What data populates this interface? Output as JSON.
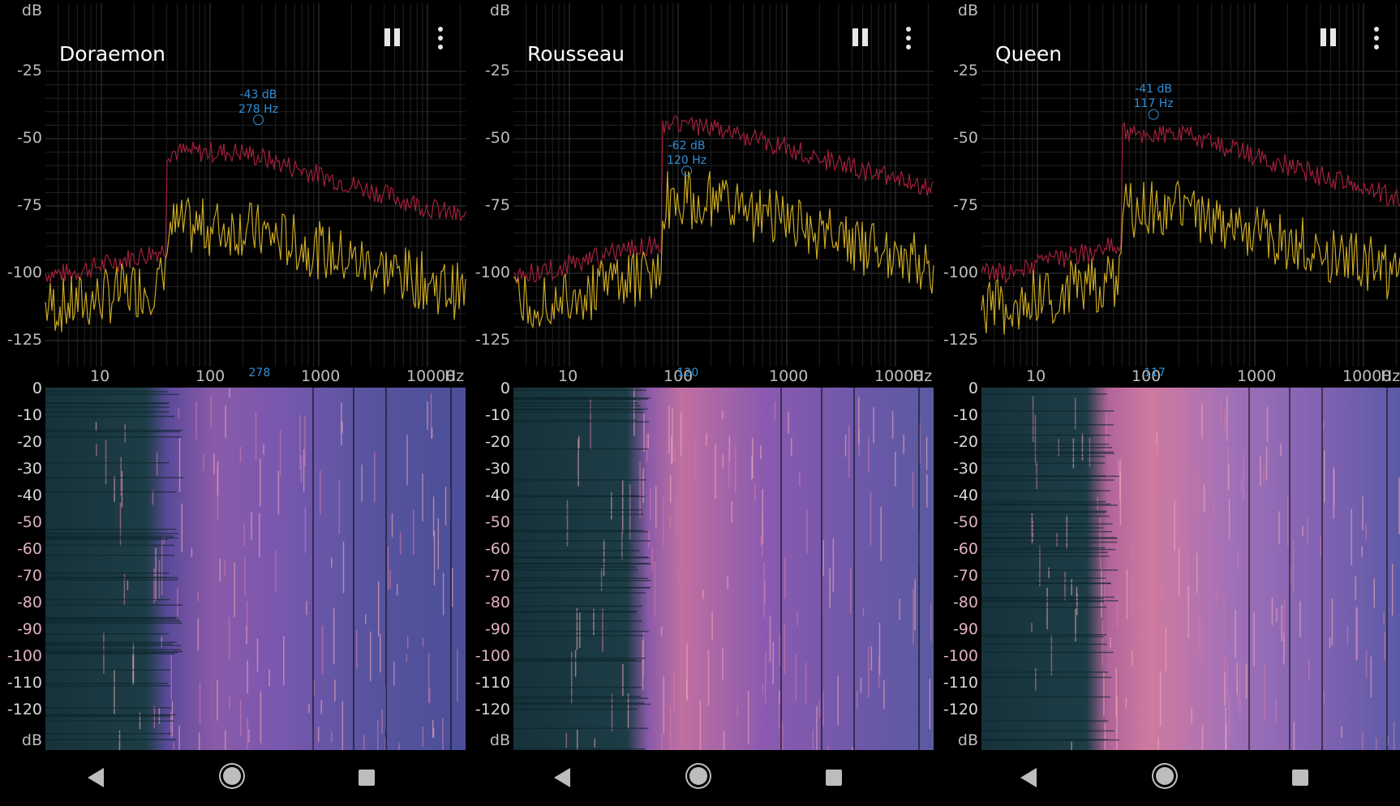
{
  "colors": {
    "background": "#000000",
    "grid": "#3a3a3a",
    "curve_peak_hold": "#a0203a",
    "curve_live": "#c9a820",
    "peak_marker": "#2f8fd8"
  },
  "axes": {
    "db_unit": "dB",
    "db_ticks": [
      "-25",
      "-50",
      "-75",
      "-100",
      "-125"
    ],
    "freq_ticks": [
      "10",
      "100",
      "1000",
      "10000"
    ],
    "freq_unit": "Hz",
    "spectrogram_ticks": [
      "0",
      "-10",
      "-20",
      "-30",
      "-40",
      "-50",
      "-60",
      "-70",
      "-80",
      "-90",
      "-100",
      "-110",
      "-120"
    ],
    "spectrogram_unit": "dB"
  },
  "controls": {
    "pause_icon": "pause-icon",
    "menu_icon": "more-vert-icon"
  },
  "panels": [
    {
      "title": "Doraemon",
      "peak_db": "-43 dB",
      "peak_hz": "278 Hz",
      "peak_x_label": "278",
      "peak_freq": 278,
      "peak_level": -43
    },
    {
      "title": "Rousseau",
      "peak_db": "-62 dB",
      "peak_hz": "120 Hz",
      "peak_x_label": "120",
      "peak_freq": 120,
      "peak_level": -62
    },
    {
      "title": "Queen",
      "peak_db": "-41 dB",
      "peak_hz": "117 Hz",
      "peak_x_label": "117",
      "peak_freq": 117,
      "peak_level": -41
    }
  ],
  "navbar": {
    "back_icon": "back-icon",
    "home_icon": "home-icon",
    "recents_icon": "recents-icon"
  }
}
